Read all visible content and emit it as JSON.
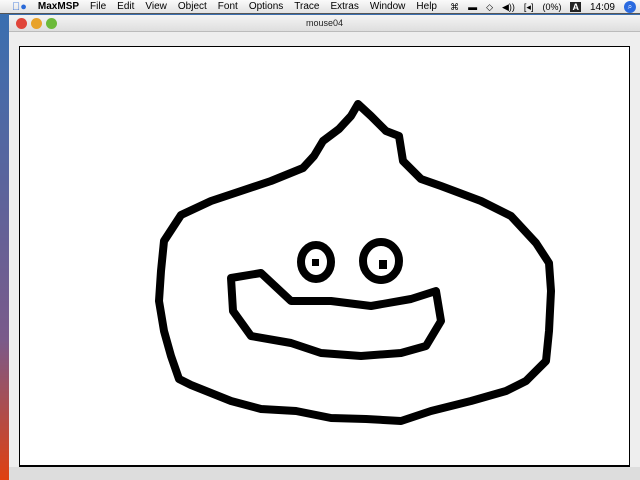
{
  "menubar": {
    "app": "MaxMSP",
    "items": [
      "File",
      "Edit",
      "View",
      "Object",
      "Font",
      "Options",
      "Trace",
      "Extras",
      "Window",
      "Help"
    ],
    "status": {
      "battery": "(0%)",
      "input_menu": "A",
      "clock": "14:09"
    }
  },
  "window": {
    "title": "mouse04"
  },
  "colors": {
    "accent": "#2a6ad8",
    "stroke": "#000000"
  }
}
